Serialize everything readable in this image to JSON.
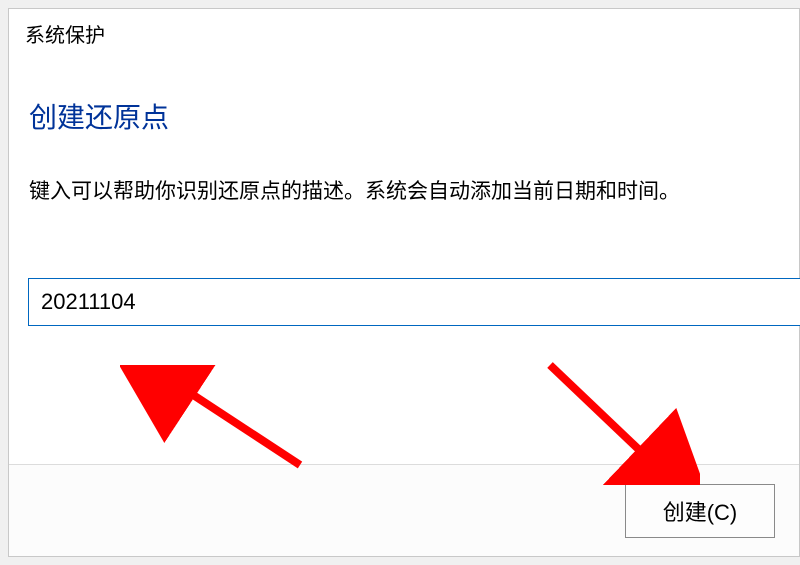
{
  "dialog": {
    "title": "系统保护",
    "heading": "创建还原点",
    "instruction": "键入可以帮助你识别还原点的描述。系统会自动添加当前日期和时间。",
    "input_value": "20211104",
    "create_button_label": "创建(C)"
  },
  "annotations": {
    "arrow_color": "#ff0000"
  }
}
